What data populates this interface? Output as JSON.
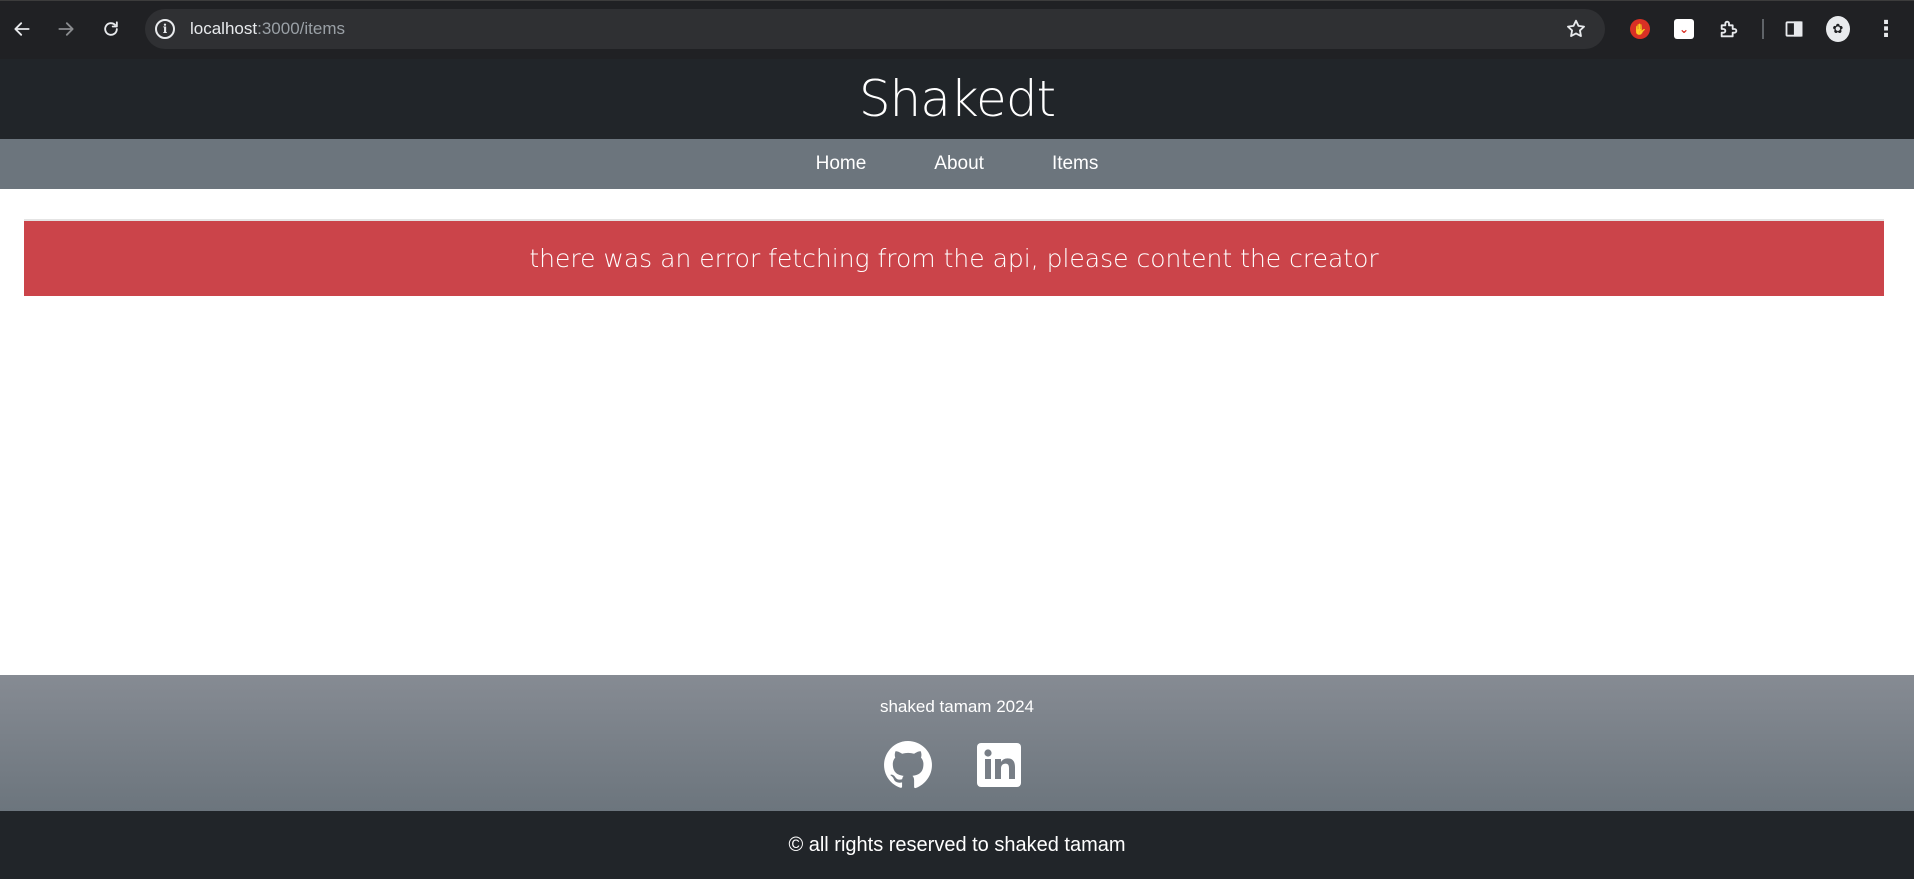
{
  "browser": {
    "url_host": "localhost",
    "url_rest": ":3000/items",
    "icons": [
      "back-icon",
      "forward-icon",
      "reload-icon",
      "info-icon",
      "star-icon",
      "adblock-icon",
      "pocket-icon",
      "extensions-icon",
      "side-panel-icon",
      "profile-icon",
      "menu-icon"
    ]
  },
  "header": {
    "title": "Shakedt"
  },
  "nav": {
    "items": [
      {
        "label": "Home"
      },
      {
        "label": "About"
      },
      {
        "label": "Items"
      }
    ]
  },
  "main": {
    "error_message": "there was an error fetching from the api, please content the creator",
    "error_color": "#cb444a"
  },
  "footer": {
    "credit": "shaked tamam 2024",
    "social": [
      "github-icon",
      "linkedin-icon"
    ]
  },
  "copyright": {
    "text": "© all rights reserved to shaked tamam"
  },
  "colors": {
    "header_bg": "#212529",
    "nav_bg": "#6c757d"
  }
}
